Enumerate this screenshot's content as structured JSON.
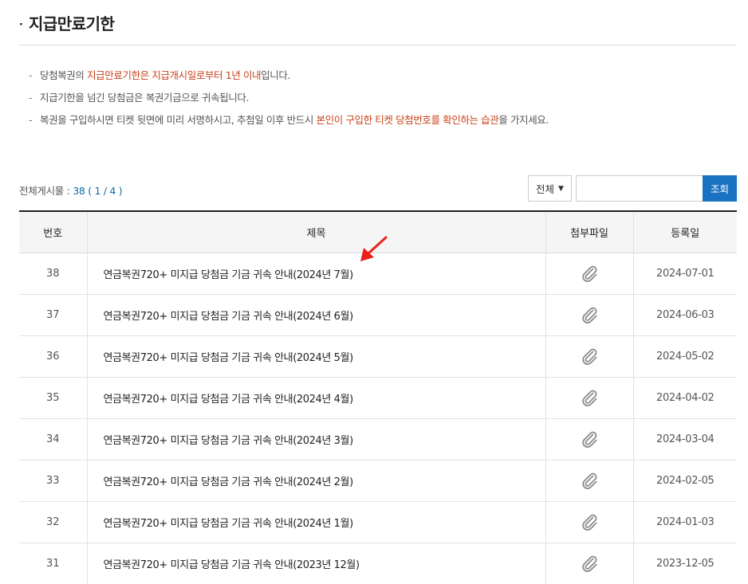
{
  "header": {
    "bullet": "·",
    "title": "지급만료기한"
  },
  "notices": [
    {
      "parts": [
        {
          "text": "당첨복권의 ",
          "hl": false
        },
        {
          "text": "지급만료기한은 지급개시일로부터 1년 이내",
          "hl": true
        },
        {
          "text": "입니다.",
          "hl": false
        }
      ]
    },
    {
      "parts": [
        {
          "text": "지급기한을 넘긴 당첨금은 복권기금으로 귀속됩니다.",
          "hl": false
        }
      ]
    },
    {
      "parts": [
        {
          "text": "복권을 구입하시면 티켓 뒷면에 미리 서명하시고, 추첨일 이후 반드시 ",
          "hl": false
        },
        {
          "text": "본인이 구입한 티켓 당첨번호를 확인하는 습관",
          "hl": true
        },
        {
          "text": "을 가지세요.",
          "hl": false
        }
      ]
    }
  ],
  "board": {
    "total_label": "전체게시물 : ",
    "total_count": "38",
    "page_info": " ( 1 / 4 )"
  },
  "search": {
    "select_value": "전체",
    "input_value": "",
    "input_placeholder": "",
    "button_label": "조회"
  },
  "table": {
    "columns": [
      "번호",
      "제목",
      "첨부파일",
      "등록일"
    ],
    "rows": [
      {
        "no": "38",
        "title": "연금복권720+ 미지급 당첨금 기금 귀속 안내(2024년 7월)",
        "date": "2024-07-01"
      },
      {
        "no": "37",
        "title": "연금복권720+ 미지급 당첨금 기금 귀속 안내(2024년 6월)",
        "date": "2024-06-03"
      },
      {
        "no": "36",
        "title": "연금복권720+ 미지급 당첨금 기금 귀속 안내(2024년 5월)",
        "date": "2024-05-02"
      },
      {
        "no": "35",
        "title": "연금복권720+ 미지급 당첨금 기금 귀속 안내(2024년 4월)",
        "date": "2024-04-02"
      },
      {
        "no": "34",
        "title": "연금복권720+ 미지급 당첨금 기금 귀속 안내(2024년 3월)",
        "date": "2024-03-04"
      },
      {
        "no": "33",
        "title": "연금복권720+ 미지급 당첨금 기금 귀속 안내(2024년 2월)",
        "date": "2024-02-05"
      },
      {
        "no": "32",
        "title": "연금복권720+ 미지급 당첨금 기금 귀속 안내(2024년 1월)",
        "date": "2024-01-03"
      },
      {
        "no": "31",
        "title": "연금복권720+ 미지급 당첨금 기금 귀속 안내(2023년 12월)",
        "date": "2023-12-05"
      }
    ],
    "attachment_icon": "paperclip-icon"
  },
  "colors": {
    "highlight": "#c8421b",
    "accent": "#1a73c2",
    "count": "#0d6aa8",
    "arrow": "#e8231c"
  }
}
